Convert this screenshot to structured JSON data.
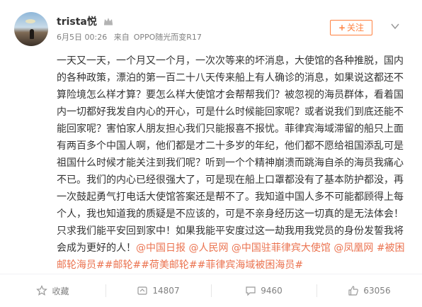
{
  "post": {
    "author": "trista悦",
    "meta": {
      "date": "6月5日 00:26",
      "source_prefix": "来自",
      "source": "OPPO随光而变R17"
    },
    "follow_label": "关注",
    "content_parts": [
      {
        "type": "text",
        "text": "一天又一天，一个月又一个月，一次次等来的坏消息，大使馆的各种推脱，国内的各种政策，漂泊的第一百二十八天传来船上有人确诊的消息，如果说这都还不算险境怎么样才算？要怎么样大使馆才会帮帮我们？被忽视的海员群体，看着国内一切都好我发自内心的开心，可是什么时候能回家呢？或者说我们到底还能不能回家呢？害怕家人朋友担心我们只能报喜不报忧。菲律宾海域滞留的船只上面有两百多个中国人啊，他们都是才二十多岁的年纪，他们都不愿给祖国添乱可是祖国什么时候才能关注到我们呢？听到一个个精神崩溃而跳海自杀的海员我痛心不已。我们的内心已经很强大了，可是现在船上口罩都没有了基本防护都没，再一次鼓起勇气打电话大使馆答案还是帮不了。我知道中国人多不可能都顾得上每个人，我也知道我的质疑是不应该的，可是不亲身经历这一切真的是无法体会！只求我们能平安回到家中！如果我能平安度过这一劫我用我党员的身份发誓我将会成为更好的人！"
      },
      {
        "type": "link",
        "text": "@中国日报"
      },
      {
        "type": "text",
        "text": " "
      },
      {
        "type": "link",
        "text": "@人民网"
      },
      {
        "type": "text",
        "text": " "
      },
      {
        "type": "link",
        "text": "@中国驻菲律宾大使馆"
      },
      {
        "type": "text",
        "text": " "
      },
      {
        "type": "link",
        "text": "@凤凰网"
      },
      {
        "type": "text",
        "text": " "
      },
      {
        "type": "link",
        "text": "#被困邮轮海员##邮轮##荷美邮轮##菲律宾海域被困海员#"
      }
    ]
  },
  "actions": {
    "favorite_label": "收藏",
    "repost_count": "14807",
    "comment_count": "9460",
    "like_count": "63056"
  },
  "colors": {
    "link": "#eb7350",
    "follow": "#ff8140",
    "meta": "#808080",
    "text": "#333333"
  }
}
